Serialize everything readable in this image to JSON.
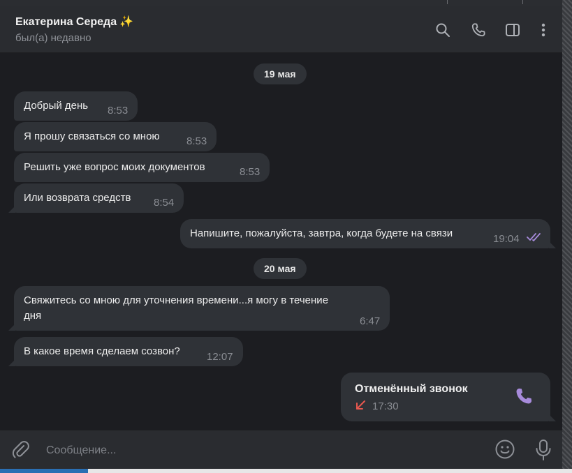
{
  "header": {
    "name": "Екатерина Середа",
    "name_emoji": "✨",
    "status": "был(а) недавно",
    "icons": [
      "search-icon",
      "phone-icon",
      "sidebar-toggle-icon",
      "more-vertical-icon"
    ]
  },
  "dates": [
    "19 мая",
    "20 мая"
  ],
  "messages": [
    {
      "text": "Добрый день",
      "time": "8:53"
    },
    {
      "text": "Я прошу связаться со мною",
      "time": "8:53"
    },
    {
      "text": "Решить уже вопрос моих документов",
      "time": "8:53"
    },
    {
      "text": "Или возврата средств",
      "time": "8:54"
    },
    {
      "text": "Напишите, пожалуйста, завтра, когда будете на связи",
      "time": "19:04"
    },
    {
      "text_line1": "Свяжитесь со мною для уточнения времени...я могу в течение",
      "text_line2": "дня",
      "time": "6:47"
    },
    {
      "text": "В какое время сделаем созвон?",
      "time": "12:07"
    }
  ],
  "call": {
    "title": "Отменённый звонок",
    "time": "17:30"
  },
  "composer": {
    "placeholder": "Сообщение...",
    "icons": [
      "paperclip-icon",
      "emoji-icon",
      "microphone-icon"
    ]
  },
  "colors": {
    "accent": "#a78bdb",
    "missed": "#e8584f",
    "bubble": "#2f3237",
    "chat_bg": "#1c1d21"
  }
}
